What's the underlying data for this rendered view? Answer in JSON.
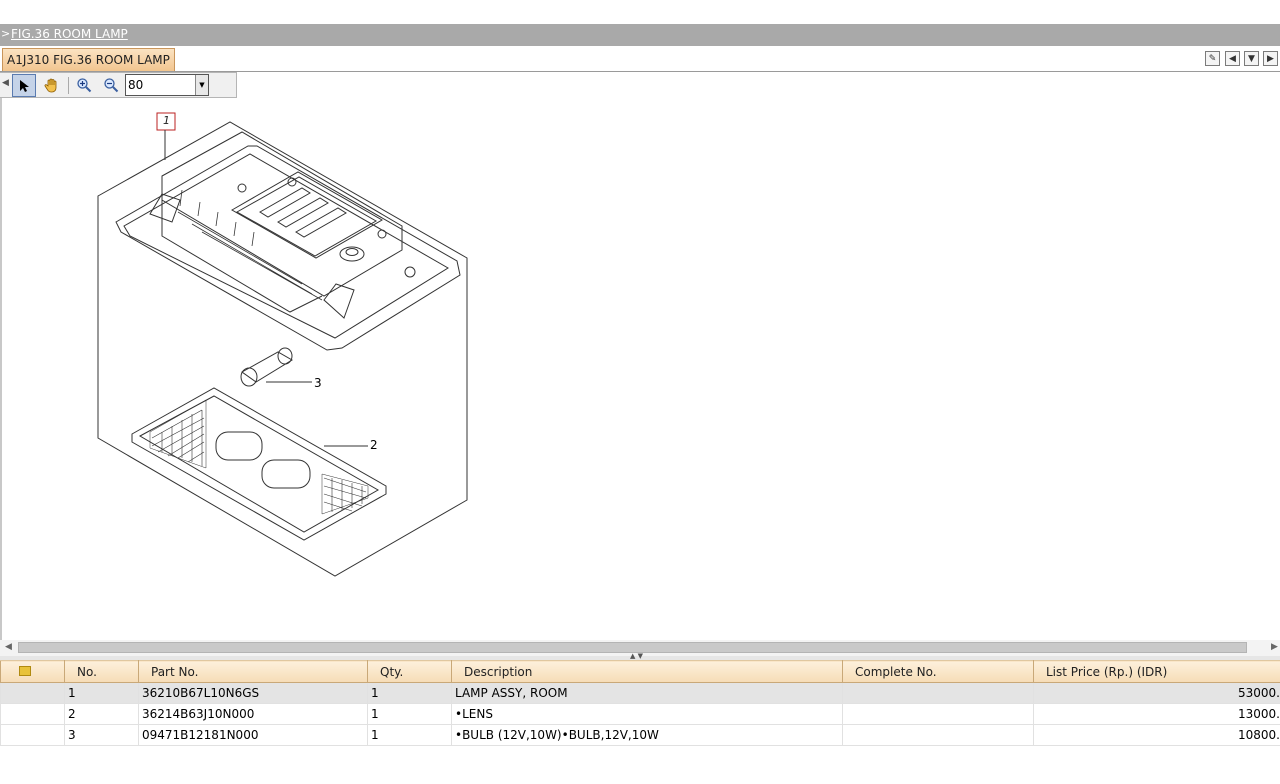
{
  "header": {
    "arrow": ">",
    "title_link": "FIG.36 ROOM LAMP"
  },
  "tab": {
    "label": "A1J310 FIG.36 ROOM LAMP"
  },
  "viewer": {
    "zoom_value": "80",
    "callouts": {
      "item1": "1",
      "item2": "2",
      "item3": "3"
    }
  },
  "table": {
    "columns": [
      "No.",
      "Part No.",
      "Qty.",
      "Description",
      "Complete No.",
      "List Price (Rp.) (IDR)"
    ],
    "rows": [
      {
        "no": "1",
        "part_no": "36210B67L10N6GS",
        "qty": "1",
        "description": "LAMP ASSY, ROOM",
        "complete_no": "",
        "price": "53000."
      },
      {
        "no": "2",
        "part_no": "36214B63J10N000",
        "qty": "1",
        "description": "•LENS",
        "complete_no": "",
        "price": "13000."
      },
      {
        "no": "3",
        "part_no": "09471B12181N000",
        "qty": "1",
        "description": "•BULB (12V,10W)•BULB,12V,10W",
        "complete_no": "",
        "price": "10800."
      }
    ]
  }
}
